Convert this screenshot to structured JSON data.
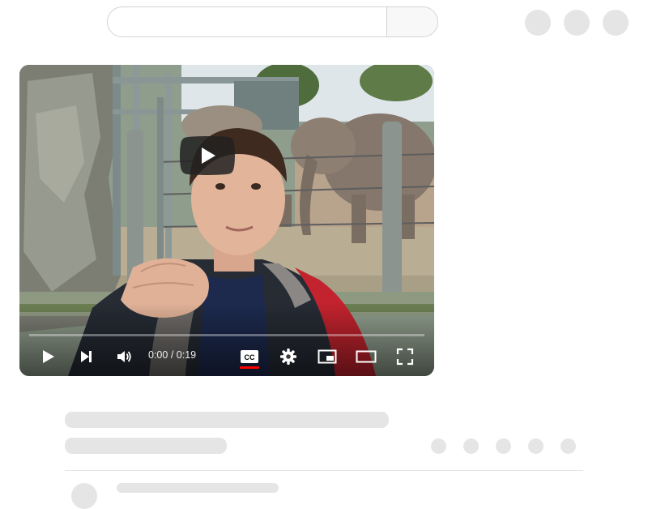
{
  "search": {
    "placeholder": ""
  },
  "player": {
    "time_current": "0:00",
    "time_separator": " / ",
    "time_total": "0:19",
    "progress_fraction": 0.0
  },
  "colors": {
    "progress": "#ff0000",
    "skeleton": "#e5e5e5",
    "play_button_bg": "#212121"
  },
  "icons": {
    "big_play": "play-icon",
    "play": "play-icon",
    "next": "next-icon",
    "volume": "volume-icon",
    "captions": "cc-icon",
    "settings": "gear-icon",
    "miniplayer": "miniplayer-icon",
    "theater": "theater-icon",
    "fullscreen": "fullscreen-icon"
  }
}
